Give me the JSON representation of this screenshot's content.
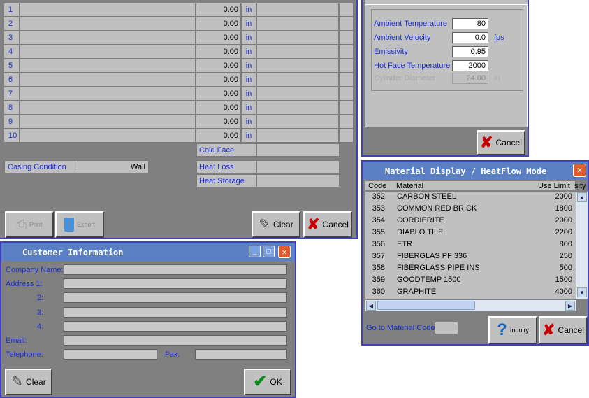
{
  "layers": [
    {
      "num": "1",
      "value": "0.00",
      "unit": "in"
    },
    {
      "num": "2",
      "value": "0.00",
      "unit": "in"
    },
    {
      "num": "3",
      "value": "0.00",
      "unit": "in"
    },
    {
      "num": "4",
      "value": "0.00",
      "unit": "in"
    },
    {
      "num": "5",
      "value": "0.00",
      "unit": "in"
    },
    {
      "num": "6",
      "value": "0.00",
      "unit": "in"
    },
    {
      "num": "7",
      "value": "0.00",
      "unit": "in"
    },
    {
      "num": "8",
      "value": "0.00",
      "unit": "in"
    },
    {
      "num": "9",
      "value": "0.00",
      "unit": "in"
    },
    {
      "num": "10",
      "value": "0.00",
      "unit": "in"
    }
  ],
  "main": {
    "cold_face": "Cold Face",
    "casing_condition_label": "Casing Condition",
    "casing_condition_value": "Wall",
    "heat_loss": "Heat Loss",
    "heat_storage": "Heat Storage",
    "print_label": "Print",
    "export_label": "Export",
    "clear_label": "Clear",
    "cancel_label": "Cancel"
  },
  "props": {
    "items": [
      {
        "label": "Ambient Temperature",
        "value": "80",
        "unit": ""
      },
      {
        "label": "Ambient Velocity",
        "value": "0.0",
        "unit": "fps"
      },
      {
        "label": "Emissivity",
        "value": "0.95",
        "unit": ""
      },
      {
        "label": "Hot Face Temperature",
        "value": "2000",
        "unit": ""
      }
    ],
    "disabled_label": "Cylinder Diameter",
    "disabled_value": "24.00",
    "disabled_unit": "in",
    "cancel_label": "Cancel"
  },
  "material": {
    "title": "Material Display / HeatFlow Mode",
    "col_code": "Code",
    "col_material": "Material",
    "col_use_limit": "Use Limit",
    "col_density": "sity",
    "rows": [
      {
        "code": "352",
        "name": "CARBON STEEL",
        "limit": "2000"
      },
      {
        "code": "353",
        "name": "COMMON RED BRICK",
        "limit": "1800"
      },
      {
        "code": "354",
        "name": "CORDIERITE",
        "limit": "2000"
      },
      {
        "code": "355",
        "name": "DIABLO TILE",
        "limit": "2200"
      },
      {
        "code": "356",
        "name": "ETR",
        "limit": "800"
      },
      {
        "code": "357",
        "name": "FIBERGLAS PF 336",
        "limit": "250"
      },
      {
        "code": "358",
        "name": "FIBERGLASS PIPE INS",
        "limit": "500"
      },
      {
        "code": "359",
        "name": "GOODTEMP 1500",
        "limit": "1500"
      },
      {
        "code": "360",
        "name": "GRAPHITE",
        "limit": "4000"
      }
    ],
    "goto_label": "Go to Material Code",
    "inquiry_label": "Inquiry",
    "cancel_label": "Cancel"
  },
  "customer": {
    "title": "Customer Information",
    "company_label": "Company Name:",
    "address_label": "Address  1:",
    "addr2": "2:",
    "addr3": "3:",
    "addr4": "4:",
    "email_label": "Email:",
    "telephone_label": "Telephone:",
    "fax_label": "Fax:",
    "clear_label": "Clear",
    "ok_label": "OK"
  }
}
